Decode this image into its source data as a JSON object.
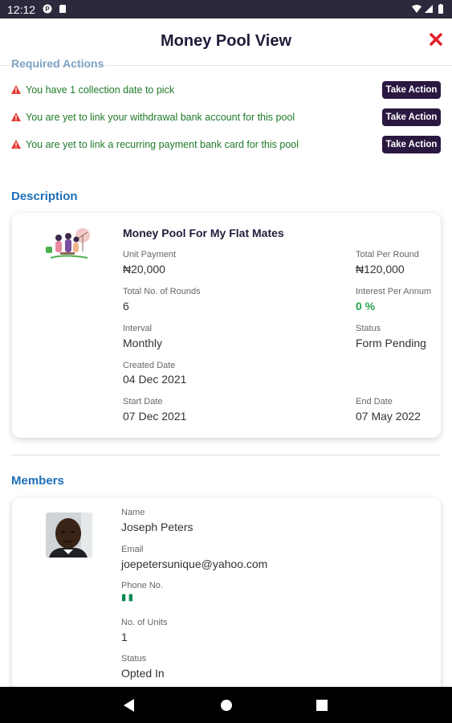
{
  "status_bar": {
    "time": "12:12"
  },
  "header": {
    "title": "Money Pool View"
  },
  "required_actions": {
    "heading": "Required Actions",
    "items": [
      {
        "text": "You have 1 collection date to pick",
        "button": "Take Action"
      },
      {
        "text": "You are yet to link your withdrawal bank account for this pool",
        "button": "Take Action"
      },
      {
        "text": "You are yet to link a recurring payment bank card for this pool",
        "button": "Take Action"
      }
    ]
  },
  "description": {
    "heading": "Description",
    "pool_name": "Money Pool For My Flat Mates",
    "unit_payment_label": "Unit Payment",
    "unit_payment": "₦20,000",
    "total_per_round_label": "Total Per Round",
    "total_per_round": "₦120,000",
    "rounds_label": "Total No. of Rounds",
    "rounds": "6",
    "interest_label": "Interest Per Annum",
    "interest": "0 %",
    "interval_label": "Interval",
    "interval": "Monthly",
    "status_label": "Status",
    "status": "Form Pending",
    "created_label": "Created Date",
    "created": "04 Dec 2021",
    "start_label": "Start Date",
    "start": "07 Dec 2021",
    "end_label": "End Date",
    "end": "07 May 2022"
  },
  "members": {
    "heading": "Members",
    "member": {
      "name_label": "Name",
      "name": "Joseph Peters",
      "email_label": "Email",
      "email": "joepetersunique@yahoo.com",
      "phone_label": "Phone No.",
      "units_label": "No. of Units",
      "units": "1",
      "status_label": "Status",
      "status": "Opted In"
    }
  },
  "colors": {
    "accent": "#1d6fb8",
    "button": "#2a1840",
    "warning": "#e53935",
    "success": "#22a64a"
  }
}
